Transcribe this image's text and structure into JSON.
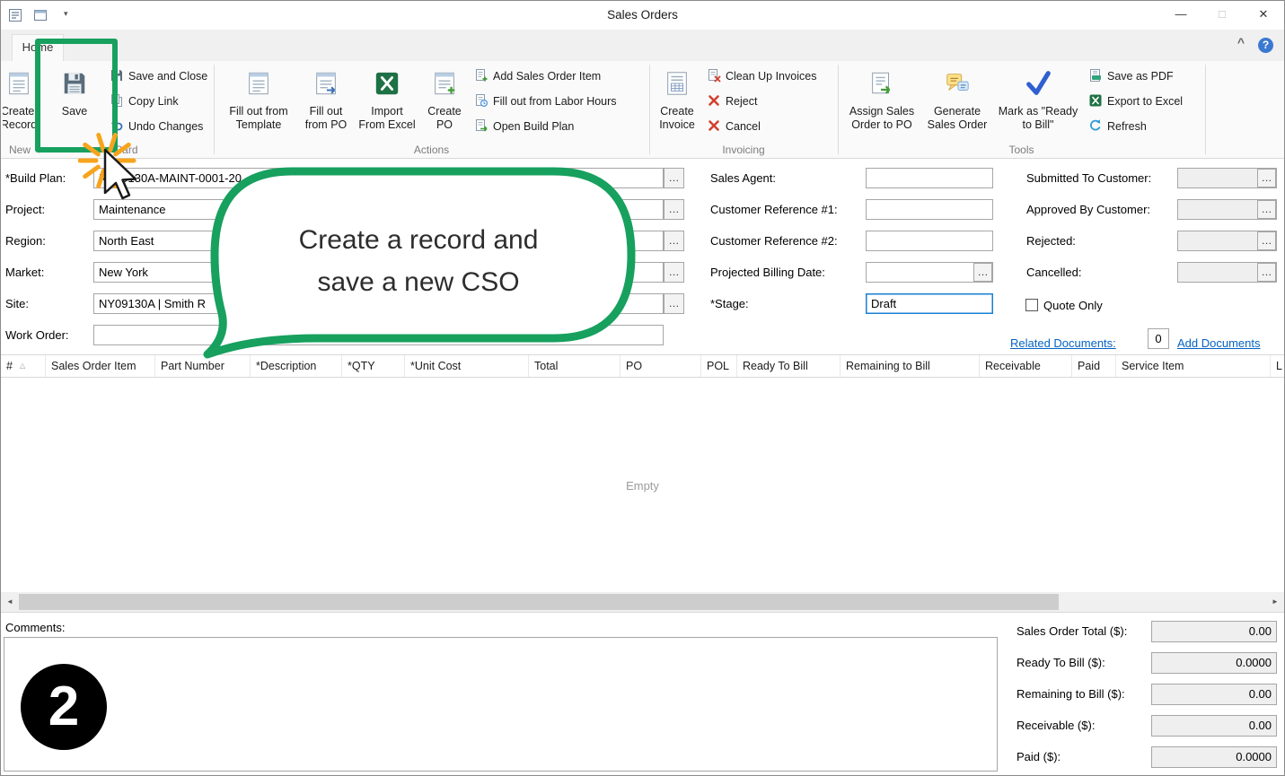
{
  "window": {
    "title": "Sales Orders"
  },
  "icons": {
    "minimize": "—",
    "maximize": "□",
    "close": "✕",
    "qat_dropdown": "▾",
    "collapse_ribbon": "^",
    "help": "?",
    "ellipsis": "…",
    "sort_ascending": "△",
    "scroll_left": "◄",
    "scroll_right": "►",
    "scroll_up": "▲",
    "scroll_down": "▼"
  },
  "colors": {
    "annotation_green": "#17a05e",
    "focus_border": "#1a7fd4",
    "link_blue": "#0563c1",
    "excel_green": "#1e7145"
  },
  "ribbon": {
    "active_tab": "Home",
    "groups": {
      "new": {
        "label": "New",
        "buttons": {
          "create_record": "Create Record"
        }
      },
      "card": {
        "label": "Card",
        "buttons": {
          "save": "Save",
          "save_and_close": "Save and Close",
          "copy_link": "Copy Link",
          "undo_changes": "Undo Changes"
        }
      },
      "actions": {
        "label": "Actions",
        "buttons": {
          "fill_out_from_template": "Fill out from Template",
          "fill_out_from_po": "Fill out from PO",
          "import_from_excel": "Import From Excel",
          "create_po": "Create PO",
          "add_sales_order_item": "Add Sales Order Item",
          "fill_out_from_labor_hours": "Fill out from Labor Hours",
          "open_build_plan": "Open Build Plan"
        }
      },
      "invoicing": {
        "label": "Invoicing",
        "buttons": {
          "create_invoice": "Create Invoice",
          "clean_up_invoices": "Clean Up Invoices",
          "reject": "Reject",
          "cancel": "Cancel"
        }
      },
      "tools": {
        "label": "Tools",
        "buttons": {
          "assign_sales_order_to_po": "Assign Sales Order to PO",
          "generate_sales_order": "Generate Sales Order",
          "mark_as_ready_to_bill": "Mark as \"Ready to Bill\"",
          "save_as_pdf": "Save as PDF",
          "export_to_excel": "Export to Excel",
          "refresh": "Refresh"
        }
      }
    }
  },
  "form": {
    "build_plan": {
      "label": "*Build Plan:",
      "value": "NY09130A-MAINT-0001-20"
    },
    "project": {
      "label": "Project:",
      "value": "Maintenance"
    },
    "region": {
      "label": "Region:",
      "value": "North East"
    },
    "market": {
      "label": "Market:",
      "value": "New York"
    },
    "site": {
      "label": "Site:",
      "value": "NY09130A | Smith R"
    },
    "work_order": {
      "label": "Work Order:",
      "value": ""
    },
    "sales_agent": {
      "label": "Sales Agent:",
      "value": ""
    },
    "customer_reference_1": {
      "label": "Customer Reference #1:",
      "value": ""
    },
    "customer_reference_2": {
      "label": "Customer Reference #2:",
      "value": ""
    },
    "projected_billing_date": {
      "label": "Projected Billing Date:",
      "value": ""
    },
    "stage": {
      "label": "*Stage:",
      "value": "Draft"
    },
    "submitted_to_customer": {
      "label": "Submitted To Customer:",
      "value": ""
    },
    "approved_by_customer": {
      "label": "Approved By Customer:",
      "value": ""
    },
    "rejected": {
      "label": "Rejected:",
      "value": ""
    },
    "cancelled": {
      "label": "Cancelled:",
      "value": ""
    },
    "quote_only": {
      "label": "Quote Only",
      "checked": false
    },
    "related_documents_link": "Related Documents:",
    "documents_count": "0",
    "add_documents_link": "Add Documents"
  },
  "table": {
    "columns": [
      "#",
      "Sales Order Item",
      "Part Number",
      "*Description",
      "*QTY",
      "*Unit Cost",
      "Total",
      "PO",
      "POL",
      "Ready To Bill",
      "Remaining to Bill",
      "Receivable",
      "Paid",
      "Service Item",
      "L"
    ],
    "empty_text": "Empty"
  },
  "comments": {
    "label": "Comments:",
    "value": ""
  },
  "totals": [
    {
      "label": "Sales Order Total ($):",
      "value": "0.00"
    },
    {
      "label": "Ready To Bill ($):",
      "value": "0.0000"
    },
    {
      "label": "Remaining to Bill ($):",
      "value": "0.00"
    },
    {
      "label": "Receivable ($):",
      "value": "0.00"
    },
    {
      "label": "Paid ($):",
      "value": "0.0000"
    }
  ],
  "annotations": {
    "callout_line1": "Create a record and",
    "callout_line2": "save a new CSO",
    "step_number": "2"
  }
}
